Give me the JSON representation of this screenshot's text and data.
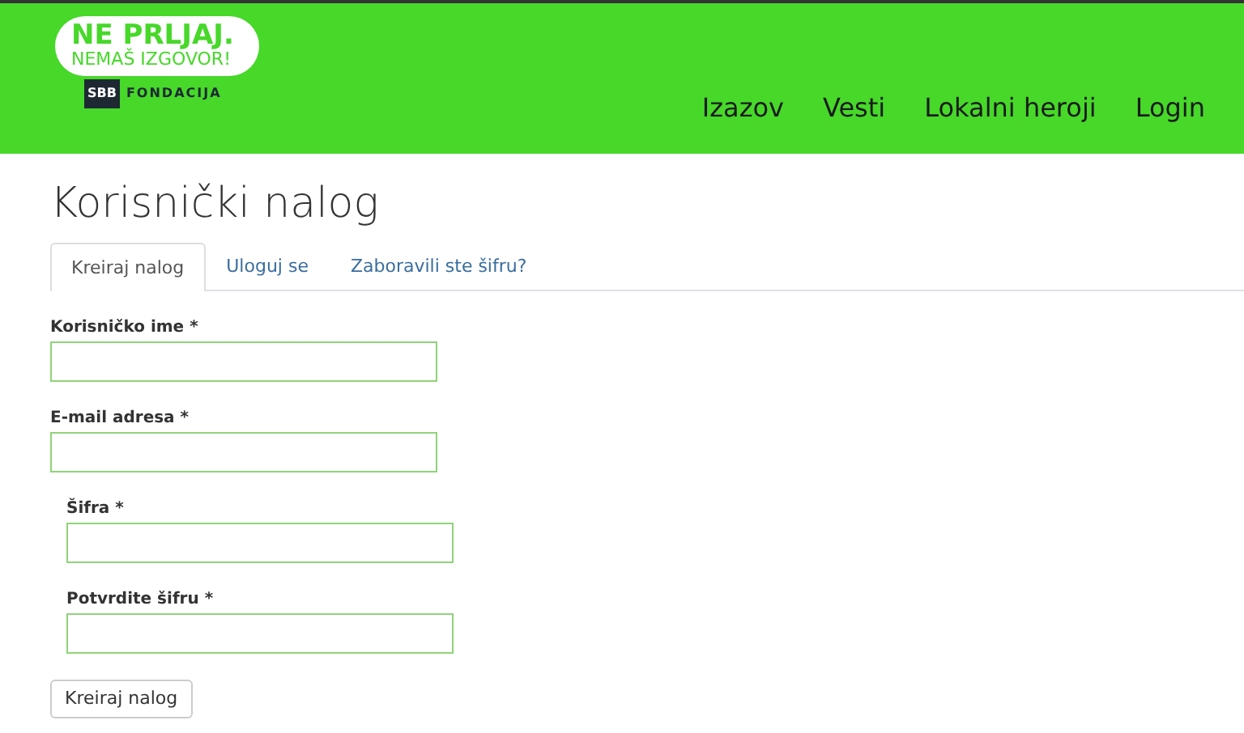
{
  "logo": {
    "line_1": "NE PRLJAJ.",
    "line_2": "NEMAŠ IZGOVOR!",
    "badge": "SBB",
    "org": "FONDACIJA"
  },
  "nav": [
    {
      "label": "Izazov"
    },
    {
      "label": "Vesti"
    },
    {
      "label": "Lokalni heroji"
    },
    {
      "label": "Login"
    }
  ],
  "page_title": "Korisnički nalog",
  "tabs": [
    {
      "label": "Kreiraj nalog",
      "selected": true
    },
    {
      "label": "Uloguj se",
      "selected": false
    },
    {
      "label": "Zaboravili ste šifru?",
      "selected": false
    }
  ],
  "fields": [
    {
      "label": "Korisničko ime *"
    },
    {
      "label": "E-mail adresa *"
    }
  ],
  "password_fields": [
    {
      "label": "Šifra *"
    },
    {
      "label": "Potvrdite šifru *"
    }
  ],
  "submit": "Kreiraj nalog"
}
